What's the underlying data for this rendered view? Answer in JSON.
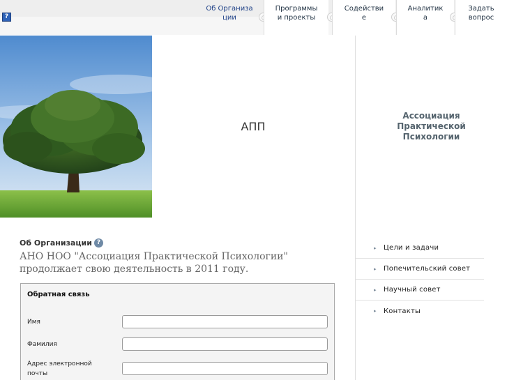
{
  "nav": {
    "help_icon": "?",
    "items": [
      {
        "label": "Об Организации",
        "active": true
      },
      {
        "label": "Программы и проекты",
        "active": false
      },
      {
        "label": "Содействие",
        "active": false
      },
      {
        "label": "Аналитика",
        "active": false
      },
      {
        "label": "Задать вопрос",
        "active": false
      }
    ]
  },
  "hero": {
    "title": "АПП",
    "org_name": "Ассоциация Практической Психологии"
  },
  "about": {
    "heading": "Об Организации",
    "help_icon": "?",
    "text": "АНО НОО \"Ассоциация Практической Психологии\" продолжает свою деятельность в 2011 году."
  },
  "form": {
    "title": "Обратная связь",
    "fields": [
      {
        "label": "Имя",
        "value": ""
      },
      {
        "label": "Фамилия",
        "value": ""
      },
      {
        "label": "Адрес электронной почты",
        "value": ""
      }
    ]
  },
  "side_menu": {
    "items": [
      {
        "label": "Цели и задачи"
      },
      {
        "label": "Попечительский совет"
      },
      {
        "label": "Научный совет"
      },
      {
        "label": "Контакты"
      }
    ]
  },
  "colors": {
    "link": "#1c3f86",
    "org_name": "#55646e",
    "sky_top": "#5c93d1",
    "grass": "#6fae3a"
  }
}
